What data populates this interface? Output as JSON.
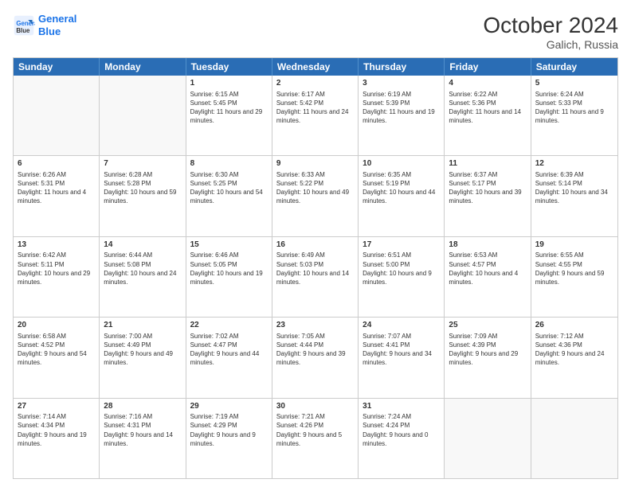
{
  "logo": {
    "line1": "General",
    "line2": "Blue"
  },
  "title": "October 2024",
  "location": "Galich, Russia",
  "header_days": [
    "Sunday",
    "Monday",
    "Tuesday",
    "Wednesday",
    "Thursday",
    "Friday",
    "Saturday"
  ],
  "weeks": [
    [
      {
        "day": "",
        "empty": true
      },
      {
        "day": "",
        "empty": true
      },
      {
        "day": "1",
        "sunrise": "Sunrise: 6:15 AM",
        "sunset": "Sunset: 5:45 PM",
        "daylight": "Daylight: 11 hours and 29 minutes."
      },
      {
        "day": "2",
        "sunrise": "Sunrise: 6:17 AM",
        "sunset": "Sunset: 5:42 PM",
        "daylight": "Daylight: 11 hours and 24 minutes."
      },
      {
        "day": "3",
        "sunrise": "Sunrise: 6:19 AM",
        "sunset": "Sunset: 5:39 PM",
        "daylight": "Daylight: 11 hours and 19 minutes."
      },
      {
        "day": "4",
        "sunrise": "Sunrise: 6:22 AM",
        "sunset": "Sunset: 5:36 PM",
        "daylight": "Daylight: 11 hours and 14 minutes."
      },
      {
        "day": "5",
        "sunrise": "Sunrise: 6:24 AM",
        "sunset": "Sunset: 5:33 PM",
        "daylight": "Daylight: 11 hours and 9 minutes."
      }
    ],
    [
      {
        "day": "6",
        "sunrise": "Sunrise: 6:26 AM",
        "sunset": "Sunset: 5:31 PM",
        "daylight": "Daylight: 11 hours and 4 minutes."
      },
      {
        "day": "7",
        "sunrise": "Sunrise: 6:28 AM",
        "sunset": "Sunset: 5:28 PM",
        "daylight": "Daylight: 10 hours and 59 minutes."
      },
      {
        "day": "8",
        "sunrise": "Sunrise: 6:30 AM",
        "sunset": "Sunset: 5:25 PM",
        "daylight": "Daylight: 10 hours and 54 minutes."
      },
      {
        "day": "9",
        "sunrise": "Sunrise: 6:33 AM",
        "sunset": "Sunset: 5:22 PM",
        "daylight": "Daylight: 10 hours and 49 minutes."
      },
      {
        "day": "10",
        "sunrise": "Sunrise: 6:35 AM",
        "sunset": "Sunset: 5:19 PM",
        "daylight": "Daylight: 10 hours and 44 minutes."
      },
      {
        "day": "11",
        "sunrise": "Sunrise: 6:37 AM",
        "sunset": "Sunset: 5:17 PM",
        "daylight": "Daylight: 10 hours and 39 minutes."
      },
      {
        "day": "12",
        "sunrise": "Sunrise: 6:39 AM",
        "sunset": "Sunset: 5:14 PM",
        "daylight": "Daylight: 10 hours and 34 minutes."
      }
    ],
    [
      {
        "day": "13",
        "sunrise": "Sunrise: 6:42 AM",
        "sunset": "Sunset: 5:11 PM",
        "daylight": "Daylight: 10 hours and 29 minutes."
      },
      {
        "day": "14",
        "sunrise": "Sunrise: 6:44 AM",
        "sunset": "Sunset: 5:08 PM",
        "daylight": "Daylight: 10 hours and 24 minutes."
      },
      {
        "day": "15",
        "sunrise": "Sunrise: 6:46 AM",
        "sunset": "Sunset: 5:05 PM",
        "daylight": "Daylight: 10 hours and 19 minutes."
      },
      {
        "day": "16",
        "sunrise": "Sunrise: 6:49 AM",
        "sunset": "Sunset: 5:03 PM",
        "daylight": "Daylight: 10 hours and 14 minutes."
      },
      {
        "day": "17",
        "sunrise": "Sunrise: 6:51 AM",
        "sunset": "Sunset: 5:00 PM",
        "daylight": "Daylight: 10 hours and 9 minutes."
      },
      {
        "day": "18",
        "sunrise": "Sunrise: 6:53 AM",
        "sunset": "Sunset: 4:57 PM",
        "daylight": "Daylight: 10 hours and 4 minutes."
      },
      {
        "day": "19",
        "sunrise": "Sunrise: 6:55 AM",
        "sunset": "Sunset: 4:55 PM",
        "daylight": "Daylight: 9 hours and 59 minutes."
      }
    ],
    [
      {
        "day": "20",
        "sunrise": "Sunrise: 6:58 AM",
        "sunset": "Sunset: 4:52 PM",
        "daylight": "Daylight: 9 hours and 54 minutes."
      },
      {
        "day": "21",
        "sunrise": "Sunrise: 7:00 AM",
        "sunset": "Sunset: 4:49 PM",
        "daylight": "Daylight: 9 hours and 49 minutes."
      },
      {
        "day": "22",
        "sunrise": "Sunrise: 7:02 AM",
        "sunset": "Sunset: 4:47 PM",
        "daylight": "Daylight: 9 hours and 44 minutes."
      },
      {
        "day": "23",
        "sunrise": "Sunrise: 7:05 AM",
        "sunset": "Sunset: 4:44 PM",
        "daylight": "Daylight: 9 hours and 39 minutes."
      },
      {
        "day": "24",
        "sunrise": "Sunrise: 7:07 AM",
        "sunset": "Sunset: 4:41 PM",
        "daylight": "Daylight: 9 hours and 34 minutes."
      },
      {
        "day": "25",
        "sunrise": "Sunrise: 7:09 AM",
        "sunset": "Sunset: 4:39 PM",
        "daylight": "Daylight: 9 hours and 29 minutes."
      },
      {
        "day": "26",
        "sunrise": "Sunrise: 7:12 AM",
        "sunset": "Sunset: 4:36 PM",
        "daylight": "Daylight: 9 hours and 24 minutes."
      }
    ],
    [
      {
        "day": "27",
        "sunrise": "Sunrise: 7:14 AM",
        "sunset": "Sunset: 4:34 PM",
        "daylight": "Daylight: 9 hours and 19 minutes."
      },
      {
        "day": "28",
        "sunrise": "Sunrise: 7:16 AM",
        "sunset": "Sunset: 4:31 PM",
        "daylight": "Daylight: 9 hours and 14 minutes."
      },
      {
        "day": "29",
        "sunrise": "Sunrise: 7:19 AM",
        "sunset": "Sunset: 4:29 PM",
        "daylight": "Daylight: 9 hours and 9 minutes."
      },
      {
        "day": "30",
        "sunrise": "Sunrise: 7:21 AM",
        "sunset": "Sunset: 4:26 PM",
        "daylight": "Daylight: 9 hours and 5 minutes."
      },
      {
        "day": "31",
        "sunrise": "Sunrise: 7:24 AM",
        "sunset": "Sunset: 4:24 PM",
        "daylight": "Daylight: 9 hours and 0 minutes."
      },
      {
        "day": "",
        "empty": true
      },
      {
        "day": "",
        "empty": true
      }
    ]
  ]
}
